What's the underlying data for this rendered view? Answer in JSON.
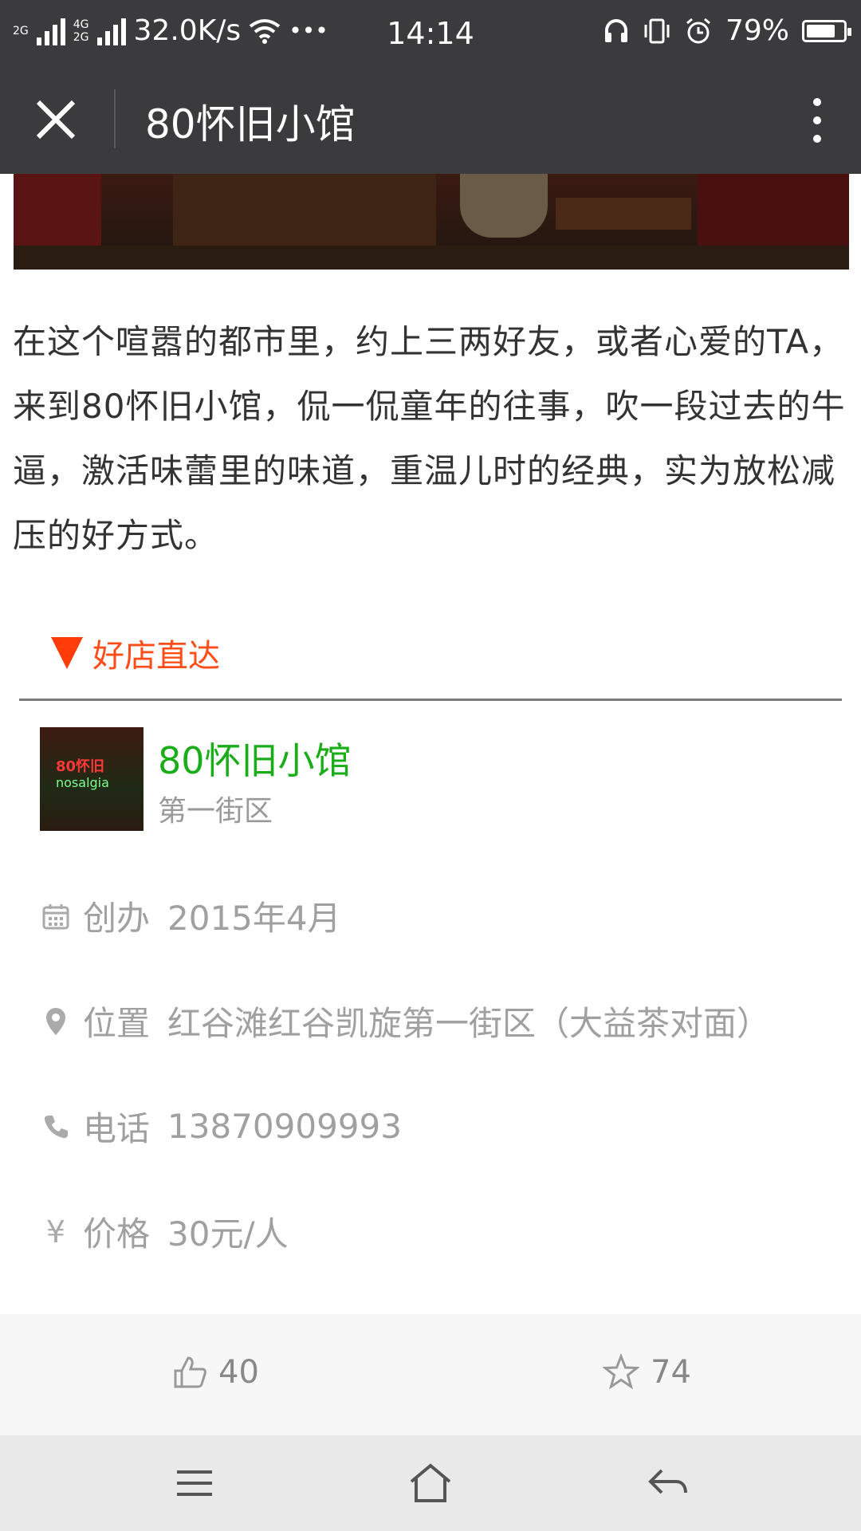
{
  "status_bar": {
    "net_top": "2G",
    "net_mid": "4G",
    "net_bot": "2G",
    "speed": "32.0K/s",
    "dots": "•••",
    "time": "14:14",
    "battery": "79%",
    "battery_level": 0.79
  },
  "nav": {
    "title": "80怀旧小馆",
    "close_icon": "close-icon",
    "more_icon": "more-vertical-icon"
  },
  "intro_text": "在这个喧嚣的都市里，约上三两好友，或者心爱的TA，来到80怀旧小馆，侃一侃童年的往事，吹一段过去的牛逼，激活味蕾里的味道，重温儿时的经典，实为放松减压的好方式。",
  "section": {
    "title": "好店直达",
    "accent": "#ff4d1a"
  },
  "shop": {
    "name": "80怀旧小馆",
    "area": "第一街区",
    "thumb_text_1": "80怀旧",
    "thumb_text_2": "nosalgia",
    "name_color": "#1aad19"
  },
  "info": [
    {
      "icon": "calendar-icon",
      "label": "创办",
      "value": "2015年4月"
    },
    {
      "icon": "location-pin-icon",
      "label": "位置",
      "value": "红谷滩红谷凯旋第一街区（大益茶对面）"
    },
    {
      "icon": "phone-icon",
      "label": "电话",
      "value": "13870909993"
    },
    {
      "icon": "yen-icon",
      "label": "价格",
      "value": "30元/人"
    }
  ],
  "actions": {
    "likes": "40",
    "favorites": "74"
  },
  "bottom_nav": {
    "menu": "menu-icon",
    "home": "home-icon",
    "back": "back-icon"
  }
}
